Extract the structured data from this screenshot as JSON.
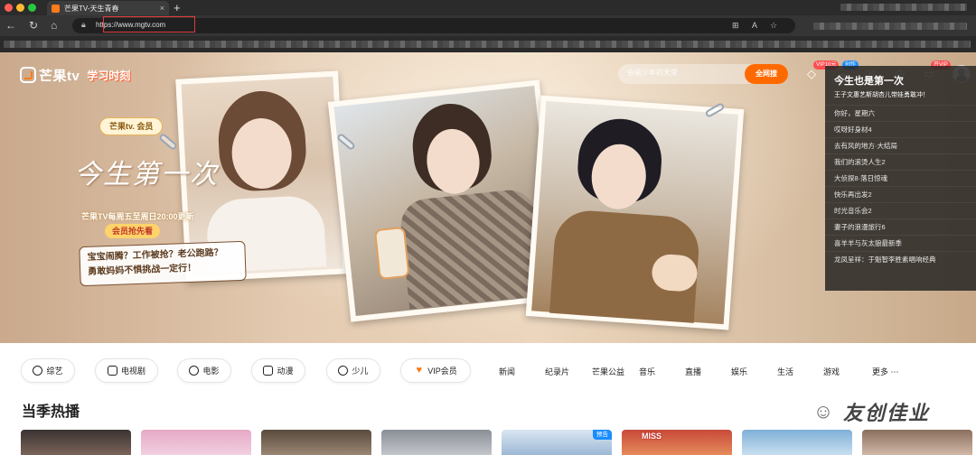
{
  "browser": {
    "tab_title": "芒果TV-天生青春",
    "tab_close": "×",
    "new_tab": "+",
    "url": "https://www.mgtv.com",
    "nav": {
      "back": "←",
      "forward": "→",
      "reload": "↻",
      "home": "⌂"
    },
    "addr_icons": [
      "⊞",
      "A",
      "☆"
    ]
  },
  "site": {
    "logo_text": "芒果tv",
    "slogan": "学习时刻",
    "search_placeholder": "会画少年的天堂",
    "search_button": "全网搜",
    "badges": {
      "vip": "VIP10元",
      "create": "创作",
      "open_vip": "开VIP"
    },
    "colors": {
      "accent": "#ff6a00",
      "brand": "#ff7a1a"
    }
  },
  "hero": {
    "vip_tag": "芒果tv. 会员",
    "show_title": "今生第一次",
    "schedule": "芒果TV每周五至周日20:00更新",
    "member_tag": "会员抢先看",
    "quote_line1": "宝宝闹腾？工作被抢？老公跑路？",
    "quote_line2": "勇敢妈妈不惧挑战一定行！"
  },
  "sidebar": {
    "title": "今生也是第一次",
    "subtitle": "王子文惠艺斯胡杏儿带娃勇敢冲！",
    "items": [
      "你好，星期六",
      "哎呀好身材4",
      "去有风的地方·大结局",
      "我们的滚烫人生2",
      "大侦探8·落日惊魂",
      "快乐再出发2",
      "时光音乐会2",
      "妻子的浪漫旅行6",
      "喜羊羊与灰太狼最新季",
      "龙凤呈祥：于魁智李胜素唱响经典"
    ]
  },
  "channels": {
    "chips": [
      "综艺",
      "电视剧",
      "电影",
      "动漫",
      "少儿",
      "VIP会员"
    ],
    "links": [
      "新闻",
      "纪录片",
      "芒果公益",
      "音乐",
      "直播",
      "娱乐",
      "生活",
      "游戏",
      "更多 ⋯"
    ]
  },
  "section": {
    "title": "当季热播",
    "preview_badge": "预告",
    "thumb_text": "MISS"
  },
  "watermark": {
    "icon": "☺",
    "text": "友创佳业"
  }
}
